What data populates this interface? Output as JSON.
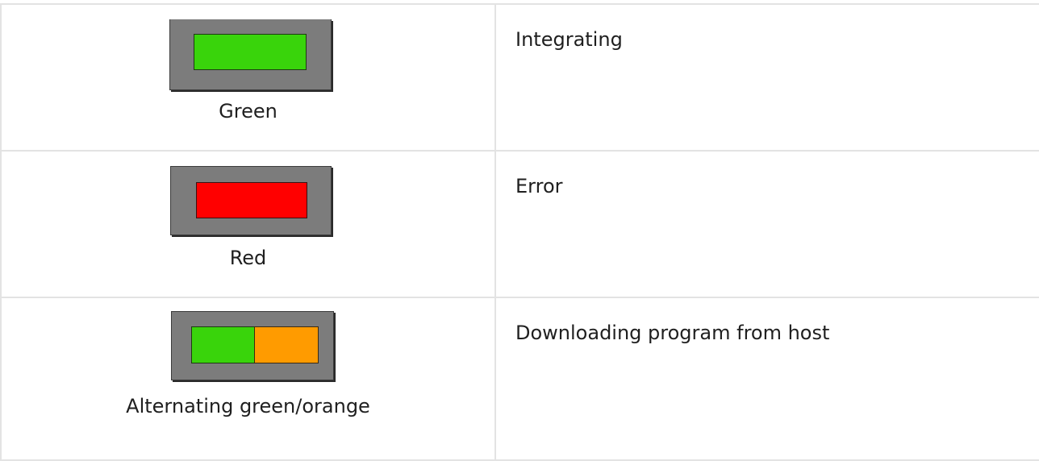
{
  "colors": {
    "green": "#39d40b",
    "red": "#ff0000",
    "orange": "#ff9b00",
    "housing": "#7c7c7c",
    "border": "#e3e3e3"
  },
  "rows": [
    {
      "caption": "Green",
      "meaning": "Integrating",
      "segments": [
        "green"
      ]
    },
    {
      "caption": "Red",
      "meaning": "Error",
      "segments": [
        "red"
      ]
    },
    {
      "caption": "Alternating green/orange",
      "meaning": "Downloading program from host",
      "segments": [
        "green",
        "orange"
      ]
    }
  ]
}
